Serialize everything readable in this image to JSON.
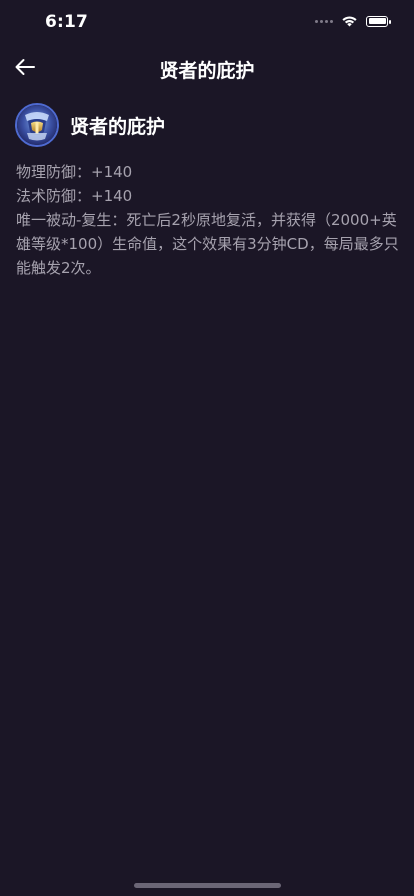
{
  "status_bar": {
    "time": "6:17"
  },
  "nav": {
    "title": "贤者的庇护"
  },
  "item": {
    "name": "贤者的庇护",
    "stats": [
      "物理防御：+140",
      "法术防御：+140",
      "唯一被动-复生：死亡后2秒原地复活，并获得（2000+英雄等级*100）生命值，这个效果有3分钟CD，每局最多只能触发2次。"
    ]
  },
  "colors": {
    "background": "#1b1626",
    "stat_text": "#a6a2ae",
    "icon_ring": "#4e6ad1"
  },
  "icons": {
    "back": "arrow-left-icon",
    "wifi": "wifi-icon",
    "battery": "battery-icon",
    "signal": "signal-icon",
    "item": "item-icon"
  }
}
